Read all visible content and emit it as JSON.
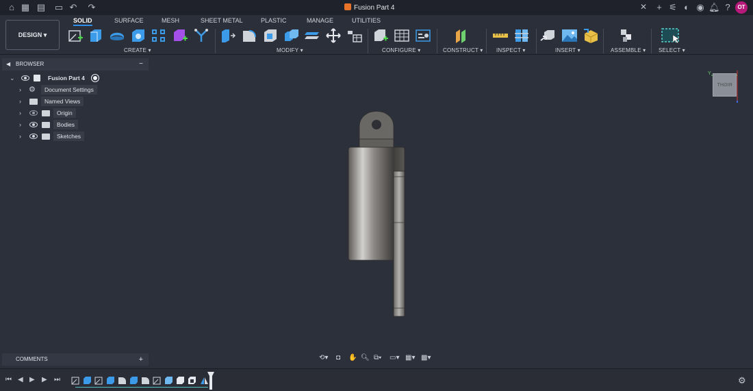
{
  "topbar": {
    "document_title": "Fusion Part 4",
    "avatar_initials": "OT",
    "accent": "#e8742a"
  },
  "toolbar": {
    "design_label": "DESIGN",
    "tabs": [
      "SOLID",
      "SURFACE",
      "MESH",
      "SHEET METAL",
      "PLASTIC",
      "MANAGE",
      "UTILITIES"
    ],
    "groups": {
      "create": "CREATE",
      "modify": "MODIFY",
      "configure": "CONFIGURE",
      "construct": "CONSTRUCT",
      "inspect": "INSPECT",
      "insert": "INSERT",
      "assemble": "ASSEMBLE",
      "select": "SELECT"
    }
  },
  "browser": {
    "title": "BROWSER",
    "root": "Fusion Part 4",
    "items": [
      "Document Settings",
      "Named Views",
      "Origin",
      "Bodies",
      "Sketches"
    ]
  },
  "comments": {
    "title": "COMMENTS"
  },
  "viewcube": {
    "face_label": "RIGHT"
  }
}
